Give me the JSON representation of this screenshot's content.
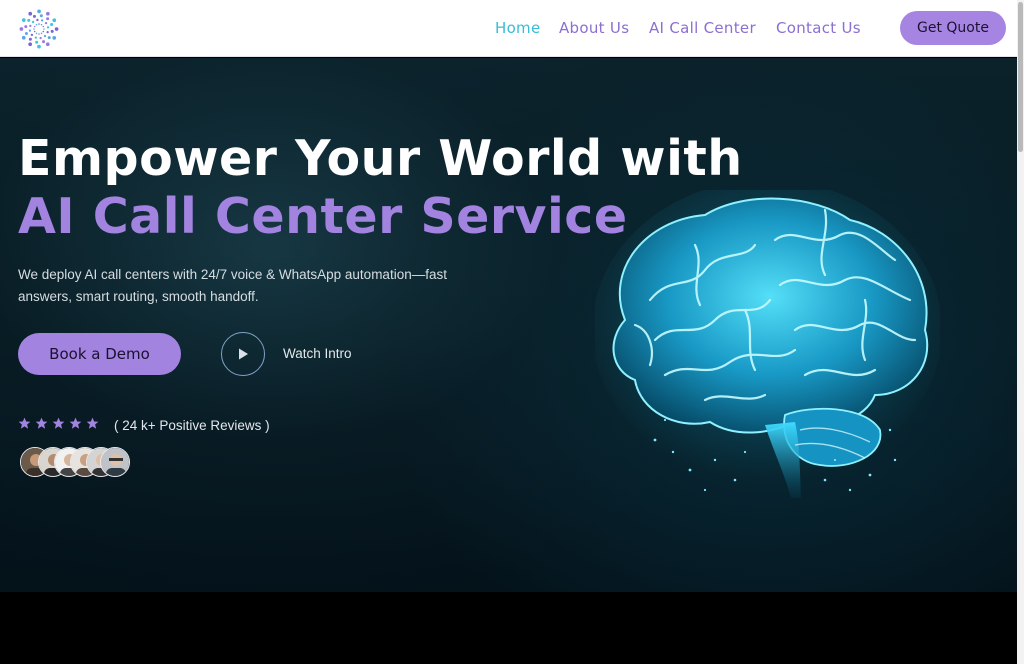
{
  "header": {
    "logo_icon": "spiral-dots-logo",
    "nav": [
      {
        "label": "Home",
        "active": true
      },
      {
        "label": "About Us",
        "active": false
      },
      {
        "label": "AI Call Center",
        "active": false
      },
      {
        "label": "Contact Us",
        "active": false
      }
    ],
    "cta_label": "Get Quote"
  },
  "hero": {
    "title_line1": "Empower Your World with",
    "title_line2": "AI Call Center Service",
    "subtitle": "We deploy AI call centers with 24/7 voice & WhatsApp automation—fast answers, smart routing, smooth handoff.",
    "primary_button": "Book a Demo",
    "secondary_button": "Watch Intro",
    "rating_stars": 5,
    "reviews_text": "( 24 k+ Positive Reviews )",
    "image_icon": "glowing-brain-illustration"
  },
  "colors": {
    "accent": "#a283e0",
    "active_nav": "#38bcd8",
    "hero_bg": "#071a22"
  }
}
